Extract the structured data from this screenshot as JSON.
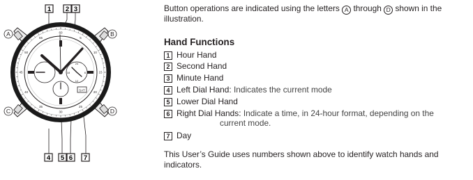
{
  "intro": {
    "text_before": "Button operations are indicated using the letters",
    "letter_a": "A",
    "through_word": "through",
    "letter_d": "D",
    "text_after_line1": "shown in the",
    "text_line2": "illustration."
  },
  "hand_functions": {
    "title": "Hand Functions",
    "items": [
      {
        "num": "1",
        "label": "Hour Hand",
        "desc": ""
      },
      {
        "num": "2",
        "label": "Second Hand",
        "desc": ""
      },
      {
        "num": "3",
        "label": "Minute Hand",
        "desc": ""
      },
      {
        "num": "4",
        "label": "Left Dial Hand:",
        "desc": "Indicates the current mode"
      },
      {
        "num": "5",
        "label": "Lower Dial Hand",
        "desc": ""
      },
      {
        "num": "6",
        "label": "Right Dial Hands:",
        "desc": "Indicate a time, in 24-hour format, depending on the",
        "desc2": "current mode."
      },
      {
        "num": "7",
        "label": "Day",
        "desc": ""
      }
    ]
  },
  "footer": {
    "line1": "This User’s Guide uses numbers shown above to identify watch hands and",
    "line2": "indicators."
  },
  "figure": {
    "button_labels": [
      "A",
      "B",
      "C",
      "D"
    ],
    "callouts_top": [
      "1",
      "2",
      "3"
    ],
    "callouts_bottom": [
      "4",
      "5",
      "6",
      "7"
    ],
    "bezel_numbers": [
      "60",
      "5",
      "10",
      "15",
      "20",
      "25",
      "30",
      "35",
      "40",
      "45",
      "50",
      "55"
    ],
    "subdial_marks": [
      "24",
      "6",
      "12",
      "18"
    ],
    "dial_text": "SAT"
  }
}
